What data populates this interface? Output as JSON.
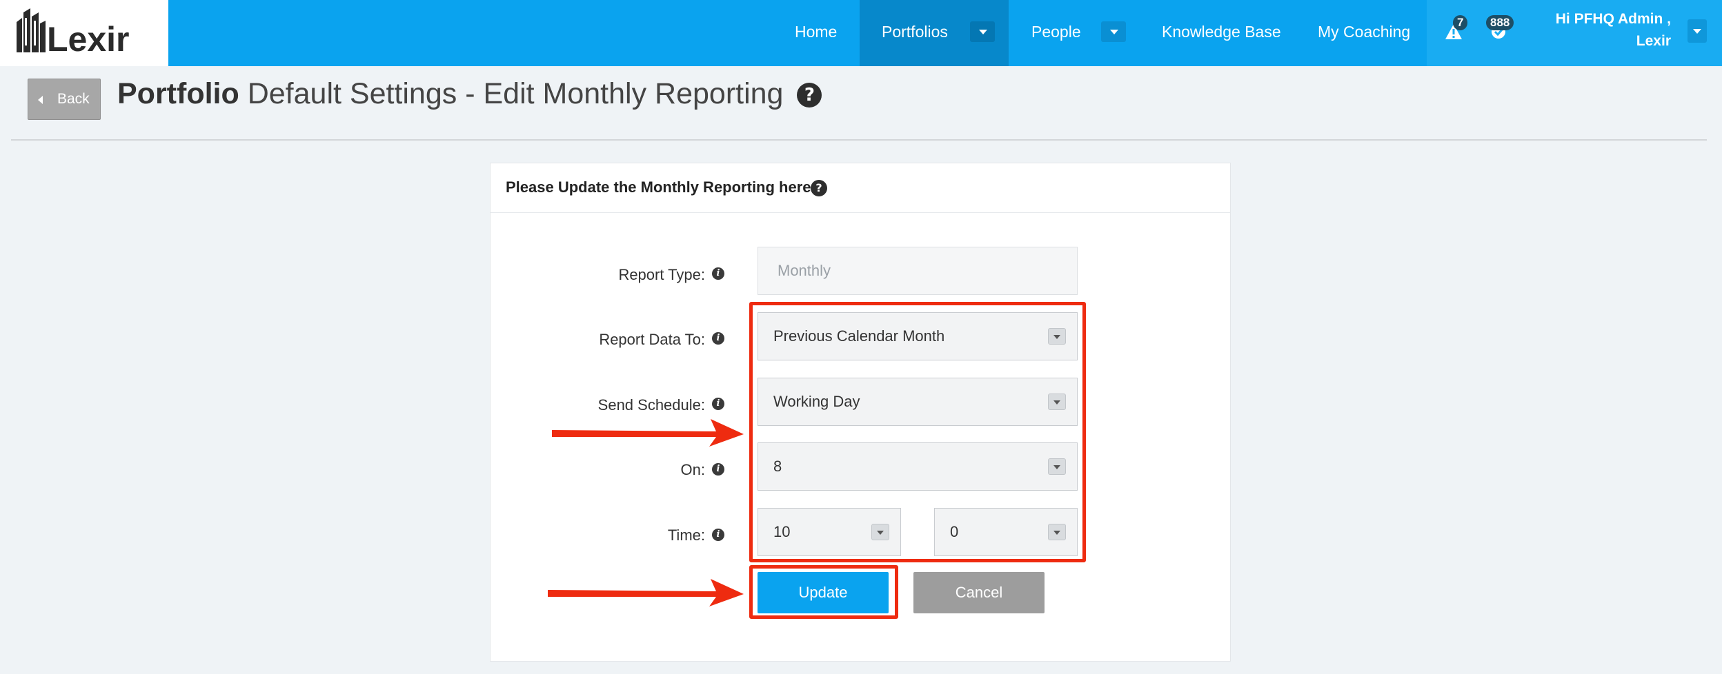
{
  "brand": {
    "logo_text": "Lexir"
  },
  "nav": {
    "items": [
      {
        "label": "Home"
      },
      {
        "label": "Portfolios"
      },
      {
        "label": "People"
      },
      {
        "label": "Knowledge Base"
      },
      {
        "label": "My Coaching"
      }
    ],
    "alerts_count": "7",
    "tasks_count": "888",
    "greeting": "Hi PFHQ Admin ,",
    "user_name": "Lexir"
  },
  "header": {
    "back_label": "Back",
    "title_bold": "Portfolio",
    "title_rest": " Default Settings - Edit Monthly Reporting"
  },
  "panel": {
    "heading": "Please Update the Monthly Reporting here:"
  },
  "form": {
    "report_type_label": "Report Type:",
    "report_type_value": "Monthly",
    "report_data_to_label": "Report Data To:",
    "report_data_to_value": "Previous Calendar Month",
    "send_schedule_label": "Send Schedule:",
    "send_schedule_value": "Working Day",
    "on_label": "On:",
    "on_value": "8",
    "time_label": "Time:",
    "time_hour_value": "10",
    "time_minute_value": "0"
  },
  "actions": {
    "update_label": "Update",
    "cancel_label": "Cancel"
  },
  "colors": {
    "navbar": "#0aa3ef",
    "nav_active": "#0788cb",
    "highlight": "#ee2b10",
    "cancel": "#9d9d9d"
  }
}
